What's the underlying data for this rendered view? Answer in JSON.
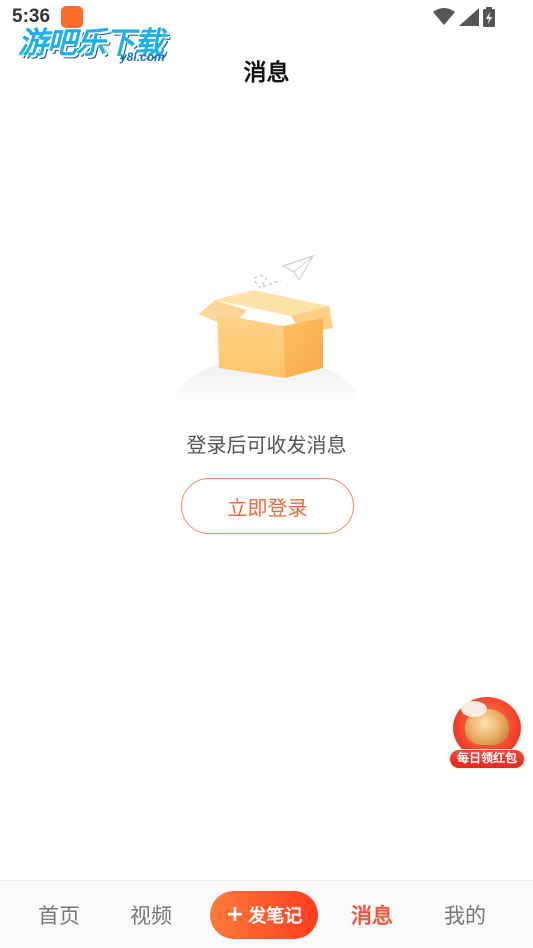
{
  "status_bar": {
    "time": "5:36",
    "icons": [
      "app-notification-icon",
      "wifi-icon",
      "cellular-signal-icon",
      "battery-charging-icon"
    ]
  },
  "watermark": {
    "text": "游吧乐下载",
    "sub": "y8l.com"
  },
  "header": {
    "title": "消息"
  },
  "empty_state": {
    "illustration": "empty-box-with-paper-plane",
    "message": "登录后可收发消息",
    "login_button": "立即登录"
  },
  "floating_promo": {
    "label": "每日领红包"
  },
  "tab_bar": {
    "home": "首页",
    "video": "视频",
    "post": "发笔记",
    "post_icon": "plus-icon",
    "messages": "消息",
    "mine": "我的",
    "active": "messages"
  },
  "colors": {
    "accent": "#f0573a",
    "button_border": "#f08a66",
    "post_gradient_start": "#ff7a3a",
    "post_gradient_end": "#ff3d1e"
  }
}
